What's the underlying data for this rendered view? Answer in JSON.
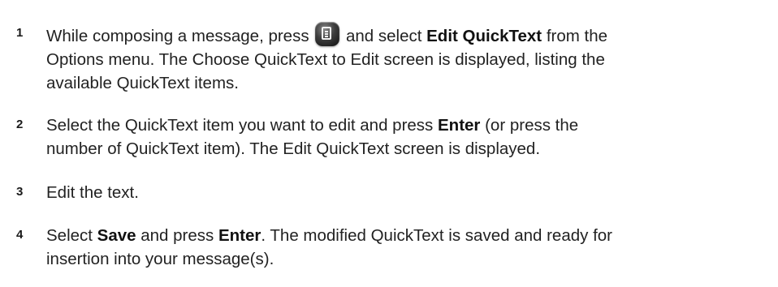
{
  "steps": [
    {
      "number": "1",
      "lines": [
        {
          "pre": "While composing a message, press ",
          "icon": "menu-key-icon",
          "post": " and select ",
          "bold": "Edit QuickText",
          "tail": " from the"
        },
        {
          "text": "Options menu. The Choose QuickText to Edit screen is displayed, listing the"
        },
        {
          "text": "available QuickText items."
        }
      ]
    },
    {
      "number": "2",
      "lines": [
        {
          "pre": "Select the QuickText item you want to edit and press ",
          "bold": "Enter",
          "tail": " (or press the"
        },
        {
          "text": "number of QuickText item). The Edit QuickText screen is displayed."
        }
      ]
    },
    {
      "number": "3",
      "lines": [
        {
          "text": "Edit the text."
        }
      ]
    },
    {
      "number": "4",
      "lines": [
        {
          "pre": "Select ",
          "bold": "Save",
          "mid": " and press ",
          "bold2": "Enter",
          "tail": ". The modified QuickText is saved and ready for"
        },
        {
          "text": "insertion into your message(s)."
        }
      ]
    }
  ]
}
